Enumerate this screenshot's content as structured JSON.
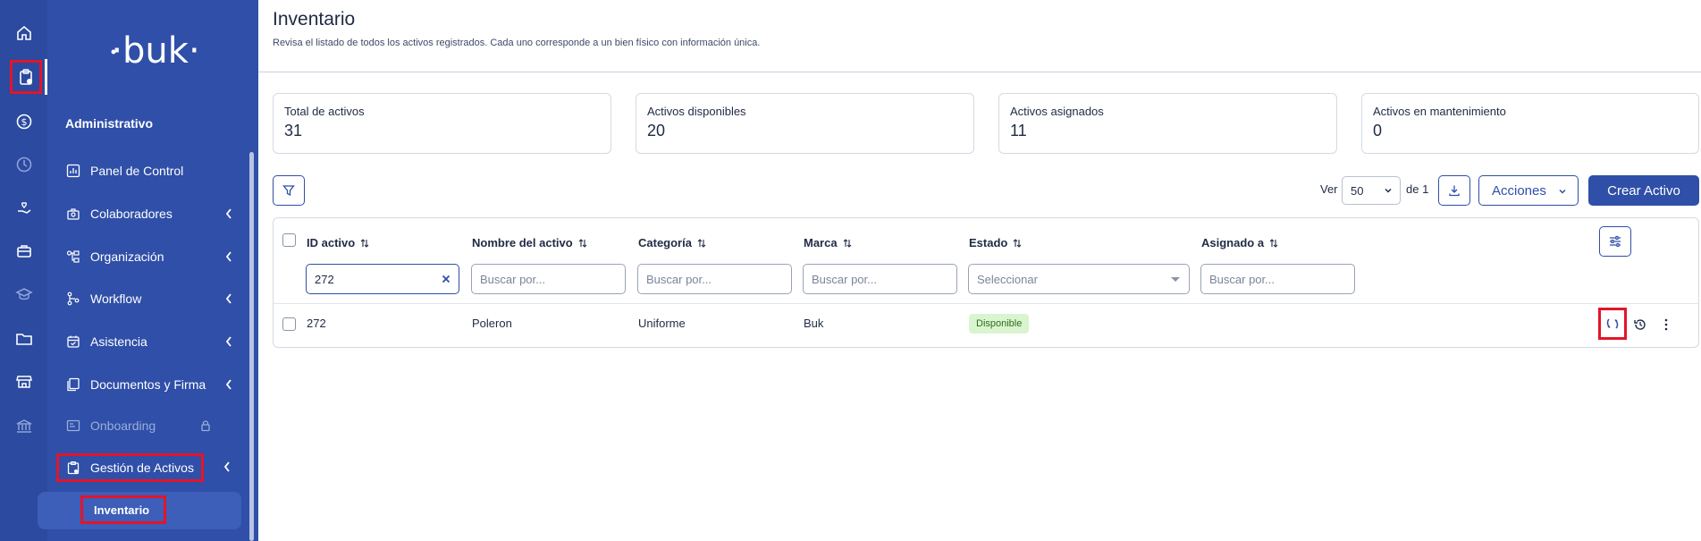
{
  "sidebar": {
    "logo": "·buk·",
    "section_title": "Administrativo",
    "items": [
      {
        "label": "Panel de Control",
        "icon": "chart-icon"
      },
      {
        "label": "Colaboradores",
        "icon": "people-icon"
      },
      {
        "label": "Organización",
        "icon": "org-icon"
      },
      {
        "label": "Workflow",
        "icon": "workflow-icon"
      },
      {
        "label": "Asistencia",
        "icon": "calendar-icon"
      },
      {
        "label": "Documentos y Firma",
        "icon": "documents-icon"
      },
      {
        "label": "Onboarding",
        "icon": "onboarding-icon"
      },
      {
        "label": "Gestión de Activos",
        "icon": "assets-icon"
      }
    ],
    "sub_item": "Inventario"
  },
  "page": {
    "title": "Inventario",
    "description": "Revisa el listado de todos los activos registrados. Cada uno corresponde a un bien físico con información única."
  },
  "stats": [
    {
      "label": "Total de activos",
      "value": "31"
    },
    {
      "label": "Activos disponibles",
      "value": "20"
    },
    {
      "label": "Activos asignados",
      "value": "11"
    },
    {
      "label": "Activos en mantenimiento",
      "value": "0"
    }
  ],
  "toolbar": {
    "ver_label": "Ver",
    "per_page": "50",
    "de_label": "de 1",
    "acciones_label": "Acciones",
    "crear_label": "Crear Activo"
  },
  "table": {
    "columns": [
      "ID activo",
      "Nombre del activo",
      "Categoría",
      "Marca",
      "Estado",
      "Asignado a"
    ],
    "filters": {
      "id_value": "272",
      "search_placeholder": "Buscar por...",
      "select_placeholder": "Seleccionar"
    },
    "rows": [
      {
        "id": "272",
        "name": "Poleron",
        "category": "Uniforme",
        "brand": "Buk",
        "status": "Disponible",
        "assigned": ""
      }
    ]
  },
  "colors": {
    "brand": "#2f4fa8",
    "highlight": "#e2152a",
    "badge_bg": "#d9f5cf"
  }
}
